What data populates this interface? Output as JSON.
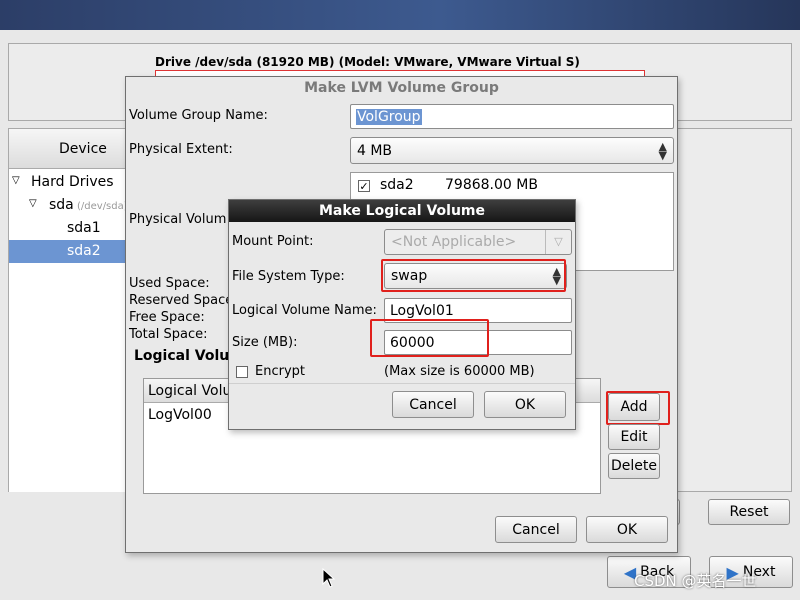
{
  "drive_info": "Drive /dev/sda (81920 MB) (Model: VMware, VMware Virtual S)",
  "device_tree": {
    "header": "Device",
    "hard_drives": "Hard Drives",
    "sda": "sda",
    "sda_path": "(/dev/sda)",
    "sda1": "sda1",
    "sda2": "sda2"
  },
  "lvm_dialog": {
    "title": "Make LVM Volume Group",
    "vg_name_label": "Volume Group Name:",
    "vg_name_value": "VolGroup",
    "pe_label": "Physical Extent:",
    "pe_value": "4 MB",
    "pv_label": "Physical Volum",
    "pv_items": [
      {
        "name": "sda2",
        "size": "79868.00 MB",
        "checked": true
      }
    ],
    "used_space": "Used Space:",
    "reserved_space": "Reserved Space",
    "free_space": "Free Space:",
    "total_space": "Total Space:",
    "lv_section": "Logical Volu",
    "lv_col": "Logical Volu",
    "lv_items": [
      "LogVol00"
    ],
    "add": "Add",
    "edit": "Edit",
    "delete": "Delete",
    "cancel": "Cancel",
    "ok": "OK"
  },
  "lv_dialog": {
    "title": "Make Logical Volume",
    "mount_label": "Mount Point:",
    "mount_placeholder": "<Not Applicable>",
    "fs_label": "File System Type:",
    "fs_value": "swap",
    "lv_name_label": "Logical Volume Name:",
    "lv_name_value": "LogVol01",
    "size_label": "Size (MB):",
    "size_value": "60000",
    "encrypt_label": "Encrypt",
    "max_size": "(Max size is 60000 MB)",
    "cancel": "Cancel",
    "ok": "OK"
  },
  "main_buttons": {
    "reset": "Reset",
    "back": "Back",
    "next": "Next"
  },
  "watermark": "CSDN @英名一世",
  "colors": {
    "highlight": "#e0201c",
    "selection": "#6c95d2",
    "title_bar": "#2c3e67"
  }
}
